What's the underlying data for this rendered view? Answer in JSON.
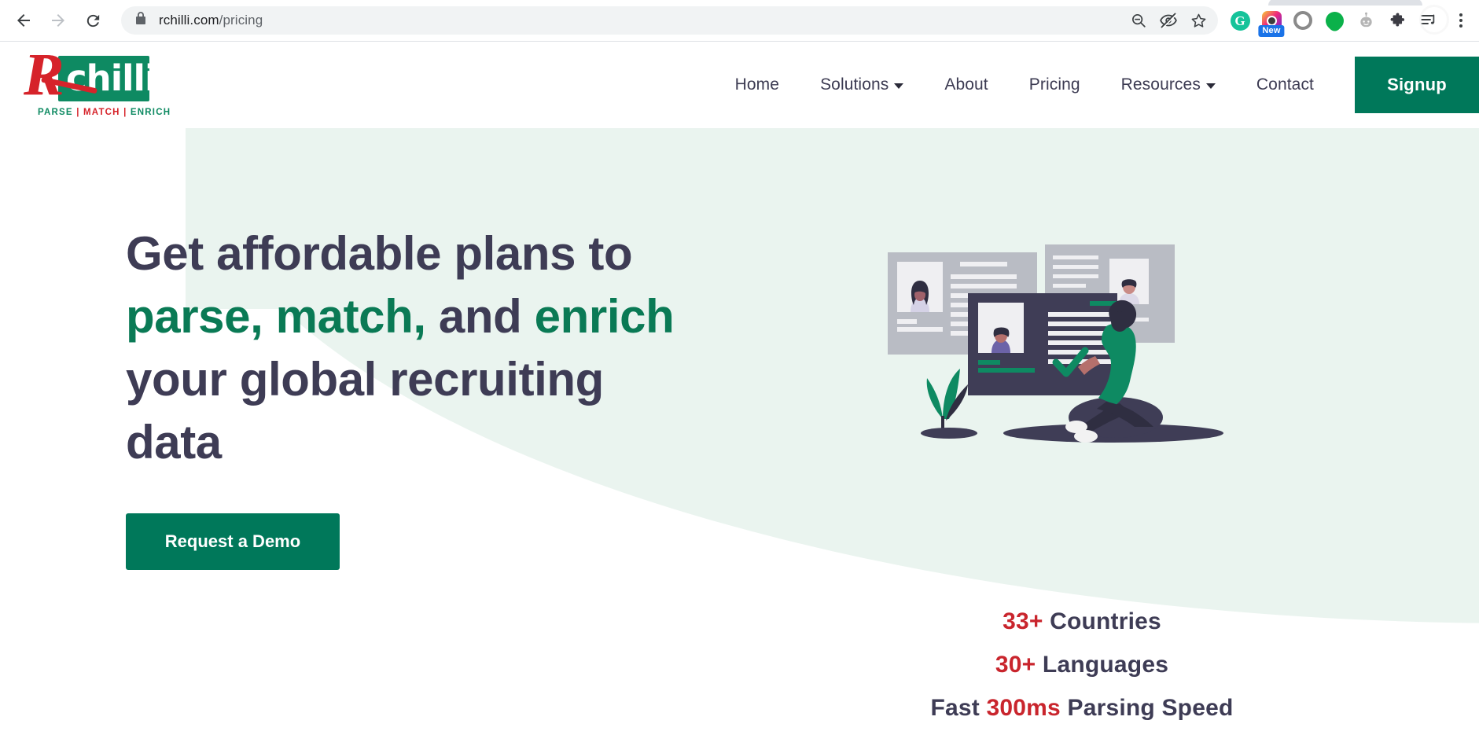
{
  "browser": {
    "back_icon": "back-arrow-icon",
    "forward_icon": "forward-arrow-icon",
    "reload_icon": "reload-icon",
    "lock_icon": "lock-icon",
    "url_domain": "rchilli.com",
    "url_path": "/pricing",
    "url_full": "rchilli.com/pricing",
    "omnibox_icons": [
      "zoom-out-icon",
      "eye-slash-icon",
      "bookmark-star-icon"
    ],
    "extensions": [
      {
        "name": "grammarly-extension-icon",
        "glyph": "G",
        "badge": ""
      },
      {
        "name": "instagram-extension-icon",
        "glyph": "",
        "badge": "New"
      },
      {
        "name": "ring-extension-icon",
        "glyph": "",
        "badge": ""
      },
      {
        "name": "green-location-pin-extension-icon",
        "glyph": "",
        "badge": ""
      },
      {
        "name": "robot-extension-icon",
        "glyph": "",
        "badge": ""
      },
      {
        "name": "puzzle-extensions-icon",
        "glyph": "",
        "badge": ""
      },
      {
        "name": "reading-list-music-icon",
        "glyph": "",
        "badge": ""
      }
    ],
    "menu_icon": "three-dots-menu-icon"
  },
  "site": {
    "logo": {
      "letter": "R",
      "word": "chilli",
      "tagline_parse": "PARSE",
      "tagline_match": "MATCH",
      "tagline_enrich": "ENRICH",
      "separator": "|",
      "red": "#d6232a",
      "green": "#0e8a62"
    },
    "nav": {
      "items": [
        {
          "label": "Home",
          "has_caret": false
        },
        {
          "label": "Solutions",
          "has_caret": true
        },
        {
          "label": "About",
          "has_caret": false
        },
        {
          "label": "Pricing",
          "has_caret": false
        },
        {
          "label": "Resources",
          "has_caret": true
        },
        {
          "label": "Contact",
          "has_caret": false
        }
      ],
      "signup_label": "Signup"
    },
    "hero": {
      "title_part1": "Get affordable plans to ",
      "title_highlight1": "parse, match,",
      "title_part2": " and ",
      "title_highlight2": "enrich",
      "title_part3": " your global recruiting data",
      "title_full": "Get affordable plans to parse, match, and enrich your global recruiting data",
      "demo_button_label": "Request a Demo",
      "illustration_name": "resume-parsing-illustration",
      "stats": [
        {
          "number": "33+",
          "label": " Countries",
          "prefix": ""
        },
        {
          "number": "30+",
          "label": " Languages",
          "prefix": ""
        },
        {
          "number": "300ms",
          "label": " Parsing Speed",
          "prefix": "Fast "
        }
      ]
    },
    "colors": {
      "brand_green": "#00785a",
      "accent_green": "#0a7a55",
      "accent_red": "#c9252d",
      "heading": "#3e3c55",
      "hero_bg": "#eaf4ef"
    }
  }
}
